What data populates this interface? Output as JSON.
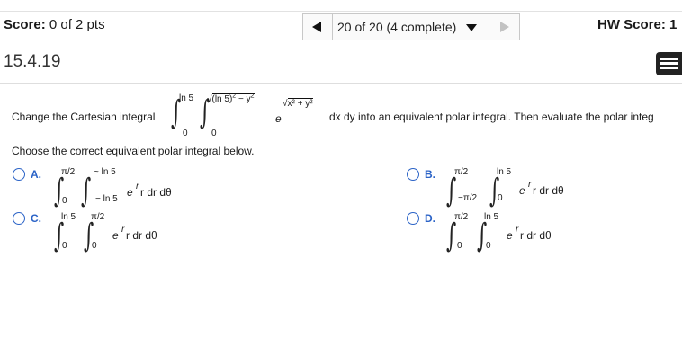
{
  "header": {
    "score_label": "Score:",
    "score_value": "0 of 2 pts",
    "question_nav": "20 of 20 (4 complete)",
    "hw_score_label": "HW Score: 1"
  },
  "question": {
    "number": "15.4.19",
    "prompt_before": "Change the Cartesian integral",
    "prompt_after": "dx dy into an equivalent polar integral. Then evaluate the polar integ",
    "outer_upper": "ln 5",
    "outer_lower": "0",
    "inner_upper_sqrt": "(ln 5)",
    "inner_upper_exp": "2",
    "inner_upper_rest": " − y",
    "inner_upper_rest_exp": "2",
    "inner_lower": "0",
    "integrand_base": "e",
    "integrand_exp": "x² + y²"
  },
  "instruction": "Choose the correct equivalent polar integral below.",
  "options": [
    {
      "letter": "A.",
      "outer_upper": "π/2",
      "outer_lower": "0",
      "inner_upper": "ln 5",
      "inner_lower": "− ln 5",
      "integrand": "r dr dθ",
      "exp": "r"
    },
    {
      "letter": "B.",
      "outer_upper": "π/2",
      "outer_lower": "−π/2",
      "inner_upper": "ln 5",
      "inner_lower": "0",
      "integrand": "r dr dθ",
      "exp": "r"
    },
    {
      "letter": "C.",
      "outer_upper": "ln 5",
      "outer_lower": "0",
      "inner_upper": "π/2",
      "inner_lower": "0",
      "integrand": "r dr dθ",
      "exp": "r"
    },
    {
      "letter": "D.",
      "outer_upper": "π/2",
      "outer_lower": "0",
      "inner_upper": "ln 5",
      "inner_lower": "0",
      "integrand": "r dr dθ",
      "exp": "r"
    }
  ],
  "icons": {
    "prev": "left-arrow-icon",
    "next": "right-arrow-icon",
    "dropdown": "caret-down-icon",
    "menu": "list-menu-icon"
  },
  "colors": {
    "accent": "#2b63c7",
    "text": "#1a1a1a"
  }
}
